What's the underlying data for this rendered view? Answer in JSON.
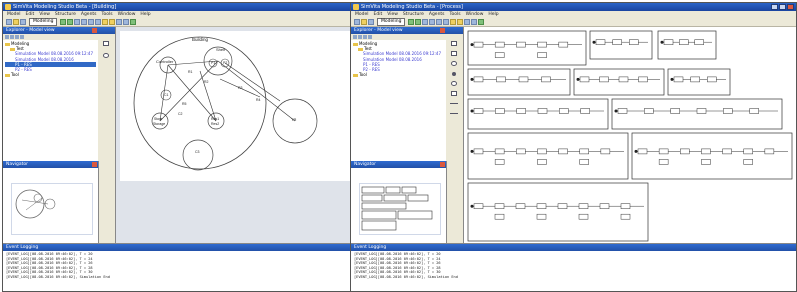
{
  "windows": [
    {
      "title": "SimVita Modeling Studio Beta - [Building]",
      "menu": [
        "Model",
        "Edit",
        "View",
        "Structure",
        "Agents",
        "Tools",
        "Window",
        "Help"
      ],
      "mode": "Modeling",
      "explorer": {
        "title": "Explorer - Model view",
        "tree": [
          "Modeling",
          "Test",
          "Simulation Model 08.08.2016 09:12:47",
          "Simulation Model 08.08.2016",
          "P1 - RES",
          "P2 - RES",
          "Tool"
        ]
      },
      "navigator_title": "Navigator",
      "event_log": {
        "title": "Event Logging",
        "lines": [
          "[EVENT_LOG][08.08.2016 09:46:02], T = 20",
          "[EVENT_LOG][08.08.2016 09:46:02], T = 24",
          "[EVENT_LOG][08.08.2016 09:46:02], T = 26",
          "[EVENT_LOG][08.08.2016 09:46:02], T = 28",
          "[EVENT_LOG][08.08.2016 09:46:02], T = 30",
          "[EVENT_LOG][08.08.2016 09:46:02], Simulation End"
        ]
      },
      "diagram_labels": {
        "building": "Building",
        "controller": "Controller",
        "shelf": "Shelf",
        "p1": "P1",
        "p2": "P2",
        "res1": "Res1",
        "res2": "Res2",
        "truck": "TR",
        "store": "Store",
        "storage": "Storage",
        "r1": "R1",
        "r2": "R2",
        "r3": "R3",
        "r4": "R4",
        "r5": "R5",
        "c1": "C1",
        "c2": "C2",
        "c3": "C3"
      }
    },
    {
      "title": "SimVita Modeling Studio Beta - [Process]",
      "menu": [
        "Model",
        "Edit",
        "View",
        "Structure",
        "Agents",
        "Tools",
        "Window",
        "Help"
      ],
      "mode": "Modeling",
      "explorer": {
        "title": "Explorer - Model view",
        "tree": [
          "Modeling",
          "Test",
          "Simulation Model 08.08.2016 09:12:47",
          "Simulation Model 08.08.2016",
          "P1 - RES",
          "P2 - RES",
          "Tool"
        ]
      },
      "navigator_title": "Navigator",
      "event_log": {
        "title": "Event Logging",
        "lines": [
          "[EVENT_LOG][08.08.2016 09:46:02], T = 20",
          "[EVENT_LOG][08.08.2016 09:46:02], T = 24",
          "[EVENT_LOG][08.08.2016 09:46:02], T = 26",
          "[EVENT_LOG][08.08.2016 09:46:02], T = 28",
          "[EVENT_LOG][08.08.2016 09:46:02], T = 30",
          "[EVENT_LOG][08.08.2016 09:46:02], Simulation End"
        ]
      }
    }
  ]
}
